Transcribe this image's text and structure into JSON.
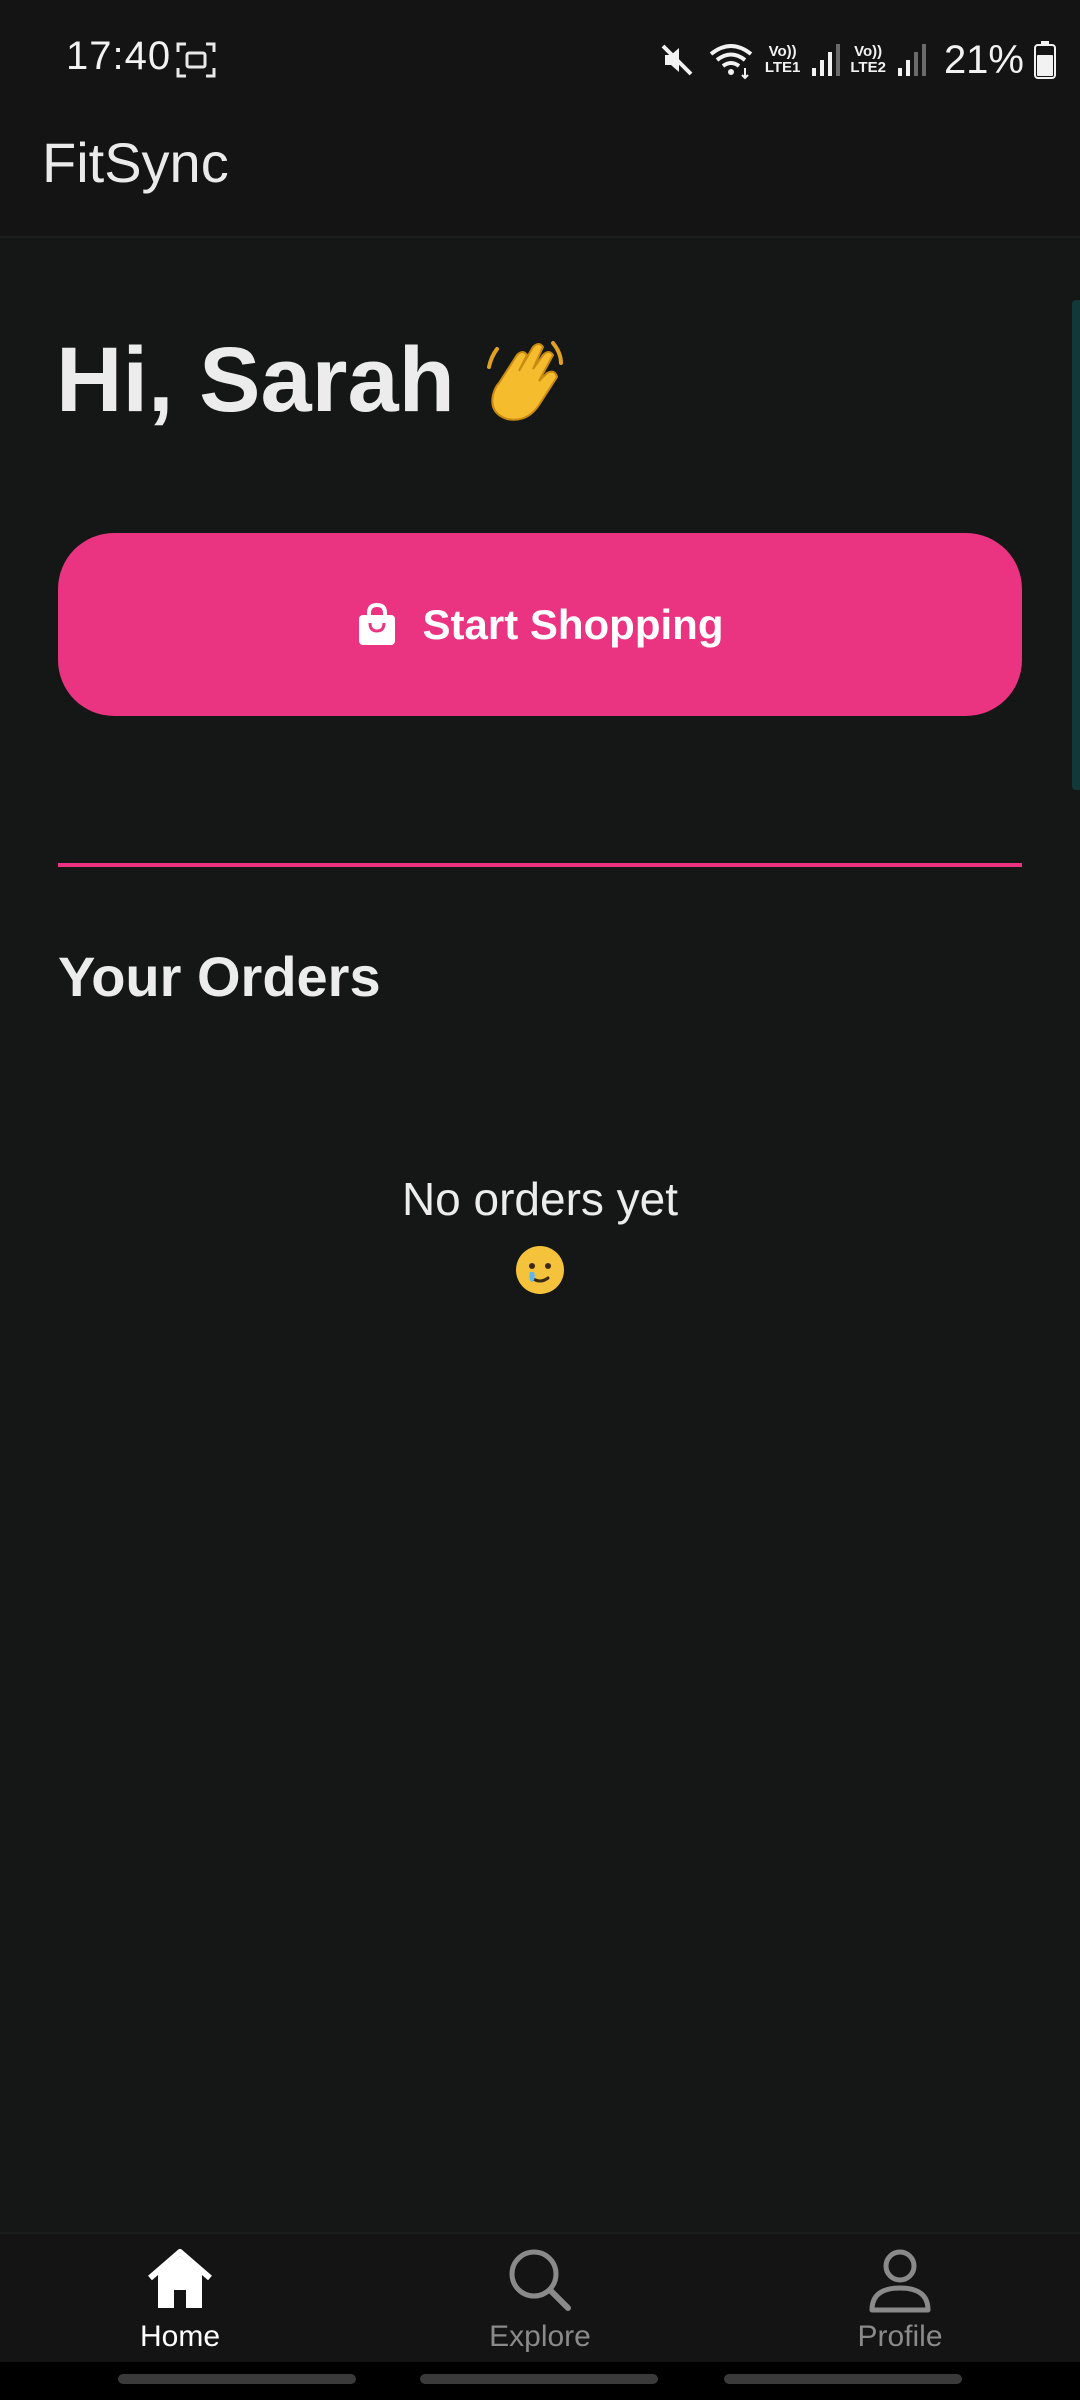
{
  "status_bar": {
    "time": "17:40",
    "battery_percent": "21%",
    "lte1_label": "LTE1",
    "lte2_label": "LTE2",
    "vo_label": "Vo))",
    "icons": [
      "screenshot-icon",
      "mute-icon",
      "wifi-icon",
      "signal-icon",
      "battery-icon"
    ]
  },
  "app_bar": {
    "title": "FitSync"
  },
  "home": {
    "greeting": "Hi, Sarah",
    "greeting_emoji": "waving-hand-icon",
    "start_button_label": "Start Shopping",
    "orders_title": "Your Orders",
    "empty_text": "No orders yet",
    "empty_emoji": "face-holding-back-tears-icon"
  },
  "bottom_nav": {
    "items": [
      {
        "label": "Home",
        "icon": "home-icon",
        "active": true
      },
      {
        "label": "Explore",
        "icon": "search-icon",
        "active": false
      },
      {
        "label": "Profile",
        "icon": "person-icon",
        "active": false
      }
    ]
  },
  "colors": {
    "accent": "#ea3381",
    "background": "#151717",
    "bar_background": "#141414",
    "text": "#ececec",
    "inactive": "#8a8a8a"
  }
}
